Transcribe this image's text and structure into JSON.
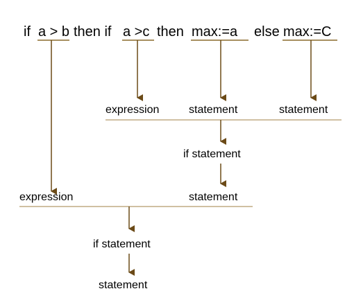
{
  "code_line": {
    "kw_if_1": "if",
    "cond_1": "a > b",
    "kw_then_if": "then if",
    "cond_2": "a >c",
    "kw_then": "then",
    "stmt_1": "max:=a",
    "kw_else": "else",
    "stmt_2": "max:=C"
  },
  "nodes": {
    "expression_inner": "expression",
    "statement_inner_1": "statement",
    "statement_inner_2": "statement",
    "if_statement_inner": "if statement",
    "statement_inner_result": "statement",
    "expression_outer": "expression",
    "if_statement_outer": "if statement",
    "statement_final": "statement"
  },
  "colors": {
    "underline": "#8a6a2c",
    "arrow": "#6b4a17",
    "rule": "#b39a6a",
    "text": "#000000"
  }
}
